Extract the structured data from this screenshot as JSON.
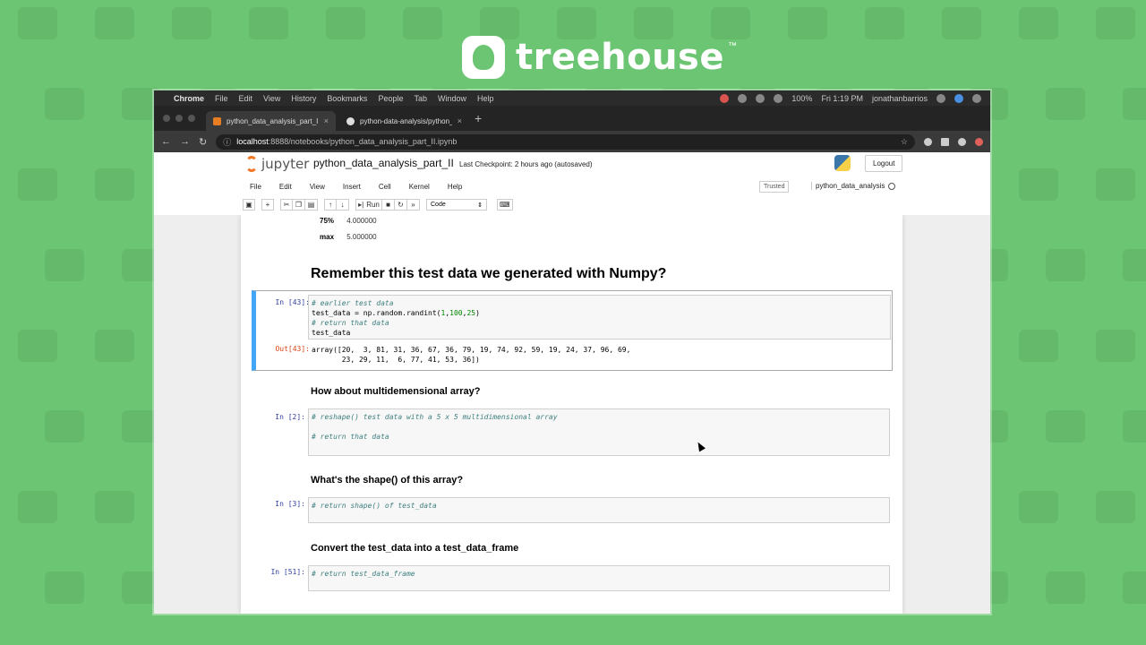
{
  "brand": {
    "name": "treehouse",
    "tm": "™"
  },
  "menubar": {
    "app": "Chrome",
    "items": [
      "File",
      "Edit",
      "View",
      "History",
      "Bookmarks",
      "People",
      "Tab",
      "Window",
      "Help"
    ],
    "battery": "100%",
    "clock": "Fri 1:19 PM",
    "user": "jonathanbarrios"
  },
  "tabs": [
    {
      "label": "python_data_analysis_part_II -",
      "close": "×"
    },
    {
      "label": "python-data-analysis/python_",
      "close": "×"
    }
  ],
  "newtab": "+",
  "address": {
    "host": "localhost",
    "path": ":8888/notebooks/python_data_analysis_part_II.ipynb"
  },
  "jupyter": {
    "logo": "jupyter",
    "notebook_name": "python_data_analysis_part_II",
    "checkpoint": "Last Checkpoint: 2 hours ago  (autosaved)",
    "logout": "Logout",
    "menu": [
      "File",
      "Edit",
      "View",
      "Insert",
      "Cell",
      "Kernel",
      "Help"
    ],
    "trusted": "Trusted",
    "kernel": "python_data_analysis",
    "toolbar": {
      "run": "Run",
      "cell_type": "Code"
    }
  },
  "describe_rows": [
    {
      "key": "75%",
      "value": "4.000000"
    },
    {
      "key": "max",
      "value": "5.000000"
    }
  ],
  "headings": {
    "h1": "Remember this test data we generated with Numpy?",
    "h2": "How about multidemensional array?",
    "h3": "What's the shape() of this array?",
    "h4": "Convert the test_data into a test_data_frame"
  },
  "cells": {
    "c43": {
      "in_prompt": "In [43]:",
      "out_prompt": "Out[43]:",
      "line1": "# earlier test data",
      "line2a": "test_data = np.random.randint(",
      "n1": "1",
      "n2": "100",
      "n3": "25",
      "line3": "# return that data",
      "line4": "test_data",
      "out1": "array([20,  3, 81, 31, 36, 67, 36, 79, 19, 74, 92, 59, 19, 24, 37, 96, 69,",
      "out2": "       23, 29, 11,  6, 77, 41, 53, 36])"
    },
    "c2": {
      "in_prompt": "In [2]:",
      "line1": "# reshape() test data with a 5 x 5 multidimensional array",
      "line2": "# return that data"
    },
    "c3": {
      "in_prompt": "In [3]:",
      "line1": "# return shape() of test_data"
    },
    "c51": {
      "in_prompt": "In [51]:",
      "line1": "# return test_data_frame"
    }
  }
}
